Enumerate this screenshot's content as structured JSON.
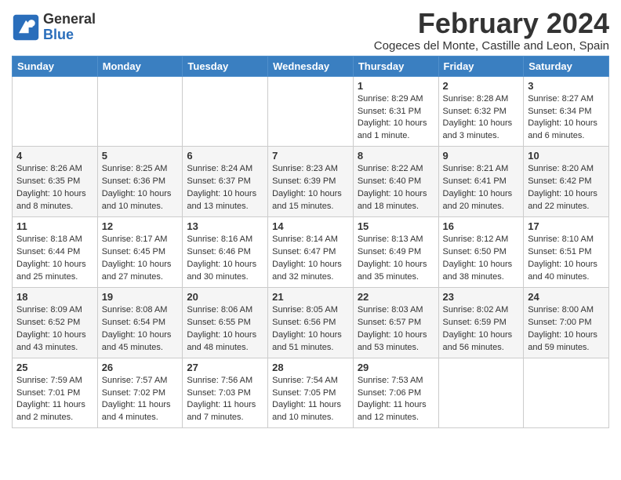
{
  "header": {
    "logo_general": "General",
    "logo_blue": "Blue",
    "month_title": "February 2024",
    "subtitle": "Cogeces del Monte, Castille and Leon, Spain"
  },
  "days_of_week": [
    "Sunday",
    "Monday",
    "Tuesday",
    "Wednesday",
    "Thursday",
    "Friday",
    "Saturday"
  ],
  "weeks": [
    [
      {
        "day": "",
        "info": ""
      },
      {
        "day": "",
        "info": ""
      },
      {
        "day": "",
        "info": ""
      },
      {
        "day": "",
        "info": ""
      },
      {
        "day": "1",
        "info": "Sunrise: 8:29 AM\nSunset: 6:31 PM\nDaylight: 10 hours and 1 minute."
      },
      {
        "day": "2",
        "info": "Sunrise: 8:28 AM\nSunset: 6:32 PM\nDaylight: 10 hours and 3 minutes."
      },
      {
        "day": "3",
        "info": "Sunrise: 8:27 AM\nSunset: 6:34 PM\nDaylight: 10 hours and 6 minutes."
      }
    ],
    [
      {
        "day": "4",
        "info": "Sunrise: 8:26 AM\nSunset: 6:35 PM\nDaylight: 10 hours and 8 minutes."
      },
      {
        "day": "5",
        "info": "Sunrise: 8:25 AM\nSunset: 6:36 PM\nDaylight: 10 hours and 10 minutes."
      },
      {
        "day": "6",
        "info": "Sunrise: 8:24 AM\nSunset: 6:37 PM\nDaylight: 10 hours and 13 minutes."
      },
      {
        "day": "7",
        "info": "Sunrise: 8:23 AM\nSunset: 6:39 PM\nDaylight: 10 hours and 15 minutes."
      },
      {
        "day": "8",
        "info": "Sunrise: 8:22 AM\nSunset: 6:40 PM\nDaylight: 10 hours and 18 minutes."
      },
      {
        "day": "9",
        "info": "Sunrise: 8:21 AM\nSunset: 6:41 PM\nDaylight: 10 hours and 20 minutes."
      },
      {
        "day": "10",
        "info": "Sunrise: 8:20 AM\nSunset: 6:42 PM\nDaylight: 10 hours and 22 minutes."
      }
    ],
    [
      {
        "day": "11",
        "info": "Sunrise: 8:18 AM\nSunset: 6:44 PM\nDaylight: 10 hours and 25 minutes."
      },
      {
        "day": "12",
        "info": "Sunrise: 8:17 AM\nSunset: 6:45 PM\nDaylight: 10 hours and 27 minutes."
      },
      {
        "day": "13",
        "info": "Sunrise: 8:16 AM\nSunset: 6:46 PM\nDaylight: 10 hours and 30 minutes."
      },
      {
        "day": "14",
        "info": "Sunrise: 8:14 AM\nSunset: 6:47 PM\nDaylight: 10 hours and 32 minutes."
      },
      {
        "day": "15",
        "info": "Sunrise: 8:13 AM\nSunset: 6:49 PM\nDaylight: 10 hours and 35 minutes."
      },
      {
        "day": "16",
        "info": "Sunrise: 8:12 AM\nSunset: 6:50 PM\nDaylight: 10 hours and 38 minutes."
      },
      {
        "day": "17",
        "info": "Sunrise: 8:10 AM\nSunset: 6:51 PM\nDaylight: 10 hours and 40 minutes."
      }
    ],
    [
      {
        "day": "18",
        "info": "Sunrise: 8:09 AM\nSunset: 6:52 PM\nDaylight: 10 hours and 43 minutes."
      },
      {
        "day": "19",
        "info": "Sunrise: 8:08 AM\nSunset: 6:54 PM\nDaylight: 10 hours and 45 minutes."
      },
      {
        "day": "20",
        "info": "Sunrise: 8:06 AM\nSunset: 6:55 PM\nDaylight: 10 hours and 48 minutes."
      },
      {
        "day": "21",
        "info": "Sunrise: 8:05 AM\nSunset: 6:56 PM\nDaylight: 10 hours and 51 minutes."
      },
      {
        "day": "22",
        "info": "Sunrise: 8:03 AM\nSunset: 6:57 PM\nDaylight: 10 hours and 53 minutes."
      },
      {
        "day": "23",
        "info": "Sunrise: 8:02 AM\nSunset: 6:59 PM\nDaylight: 10 hours and 56 minutes."
      },
      {
        "day": "24",
        "info": "Sunrise: 8:00 AM\nSunset: 7:00 PM\nDaylight: 10 hours and 59 minutes."
      }
    ],
    [
      {
        "day": "25",
        "info": "Sunrise: 7:59 AM\nSunset: 7:01 PM\nDaylight: 11 hours and 2 minutes."
      },
      {
        "day": "26",
        "info": "Sunrise: 7:57 AM\nSunset: 7:02 PM\nDaylight: 11 hours and 4 minutes."
      },
      {
        "day": "27",
        "info": "Sunrise: 7:56 AM\nSunset: 7:03 PM\nDaylight: 11 hours and 7 minutes."
      },
      {
        "day": "28",
        "info": "Sunrise: 7:54 AM\nSunset: 7:05 PM\nDaylight: 11 hours and 10 minutes."
      },
      {
        "day": "29",
        "info": "Sunrise: 7:53 AM\nSunset: 7:06 PM\nDaylight: 11 hours and 12 minutes."
      },
      {
        "day": "",
        "info": ""
      },
      {
        "day": "",
        "info": ""
      }
    ]
  ]
}
